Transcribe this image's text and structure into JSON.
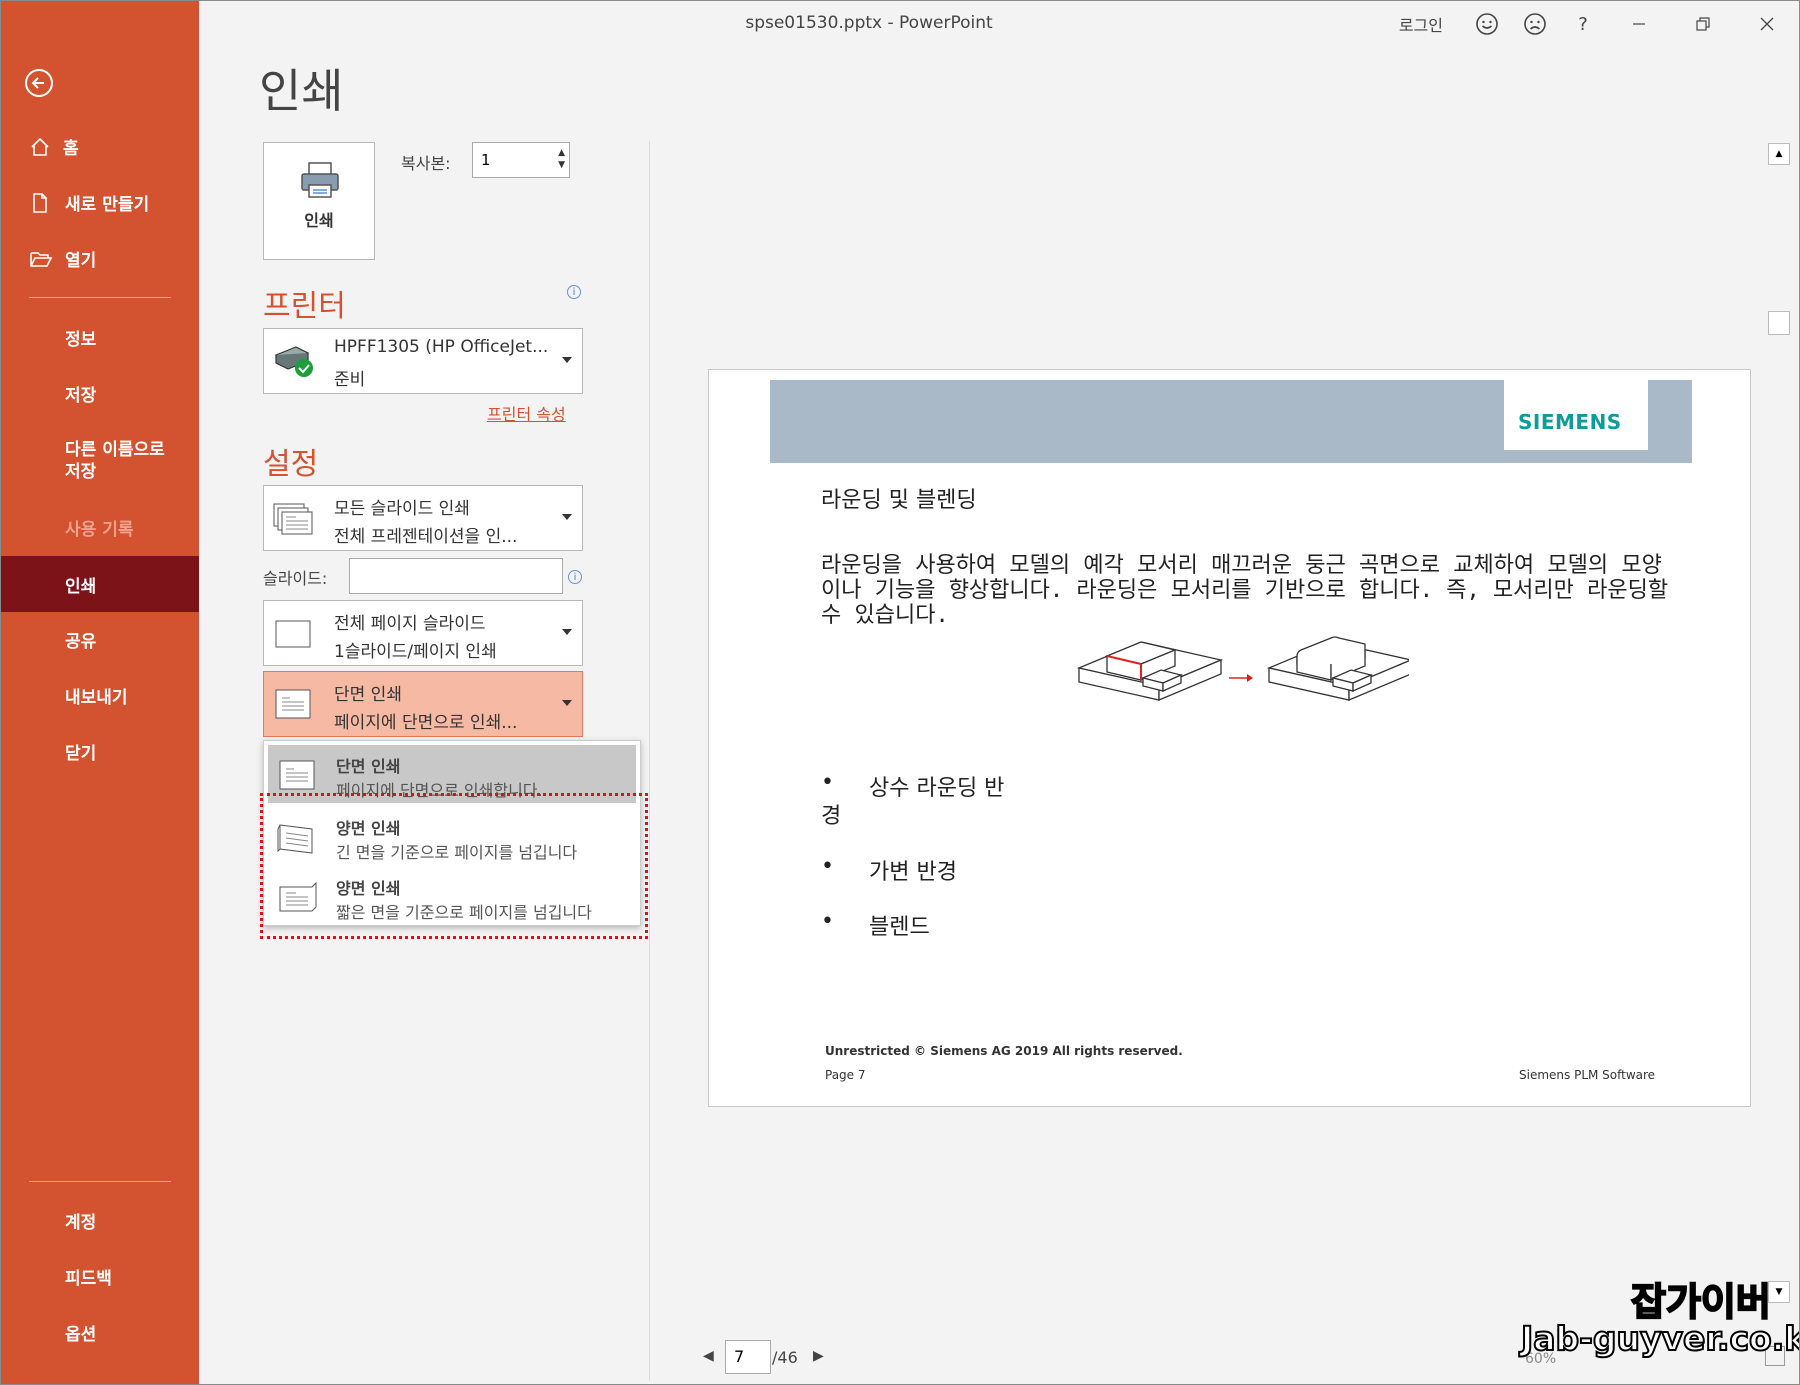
{
  "window": {
    "title": "spse01530.pptx  -  PowerPoint",
    "login": "로그인",
    "help": "?"
  },
  "sidebar": {
    "items": [
      {
        "label": "홈",
        "icon": "home-icon"
      },
      {
        "label": "새로 만들기",
        "icon": "new-document-icon"
      },
      {
        "label": "열기",
        "icon": "open-folder-icon"
      },
      {
        "label": "정보"
      },
      {
        "label": "저장"
      },
      {
        "label": "다른 이름으로\n저장"
      },
      {
        "label": "사용 기록",
        "disabled": true
      },
      {
        "label": "인쇄",
        "active": true
      },
      {
        "label": "공유"
      },
      {
        "label": "내보내기"
      },
      {
        "label": "닫기"
      }
    ],
    "bottom": [
      {
        "label": "계정"
      },
      {
        "label": "피드백"
      },
      {
        "label": "옵션"
      }
    ]
  },
  "print": {
    "heading": "인쇄",
    "button_label": "인쇄",
    "copies_label": "복사본:",
    "copies_value": "1",
    "printer_section": "프린터",
    "printer_name": "HPFF1305 (HP OfficeJet...",
    "printer_status": "준비",
    "printer_props": "프린터 속성",
    "settings_section": "설정",
    "range_l1": "모든 슬라이드 인쇄",
    "range_l2": "전체 프레젠테이션을 인...",
    "slides_label": "슬라이드:",
    "slides_value": "",
    "layout_l1": "전체 페이지 슬라이드",
    "layout_l2": "1슬라이드/페이지 인쇄",
    "sides_l1": "단면 인쇄",
    "sides_l2": "페이지에 단면으로 인쇄...",
    "menu": [
      {
        "title": "단면 인쇄",
        "desc": "페이지에 단면으로 인쇄합니다."
      },
      {
        "title": "양면 인쇄",
        "desc": "긴 면을 기준으로 페이지를 넘깁니다"
      },
      {
        "title": "양면 인쇄",
        "desc": "짧은 면을 기준으로 페이지를 넘깁니다"
      }
    ]
  },
  "preview": {
    "brand": "SIEMENS",
    "heading": "라운딩 및 블렌딩",
    "paragraph": "라운딩을 사용하여 모델의 예각 모서리 매끄러운 둥근 곡면으로 교체하여 모델의 모양이나 기능을 향상합니다. 라운딩은 모서리를 기반으로 합니다. 즉, 모서리만 라운딩할 수 있습니다.",
    "bullets": [
      "상수 라운딩 반",
      "경",
      "가변 반경",
      "블렌드"
    ],
    "footer_left": "Unrestricted © Siemens AG 2019 All rights reserved.",
    "footer_page": "Page 7",
    "footer_right": "Siemens PLM Software"
  },
  "pager": {
    "current": "7",
    "total": "/46",
    "zoom": "60%"
  },
  "watermark": {
    "line1": "잡가이버",
    "line2": "Jab-guyver.co.kr"
  },
  "colors": {
    "accent": "#d35230",
    "active": "#7b1319",
    "highlight": "#f6b9a4",
    "brand": "#0f9b9b"
  }
}
